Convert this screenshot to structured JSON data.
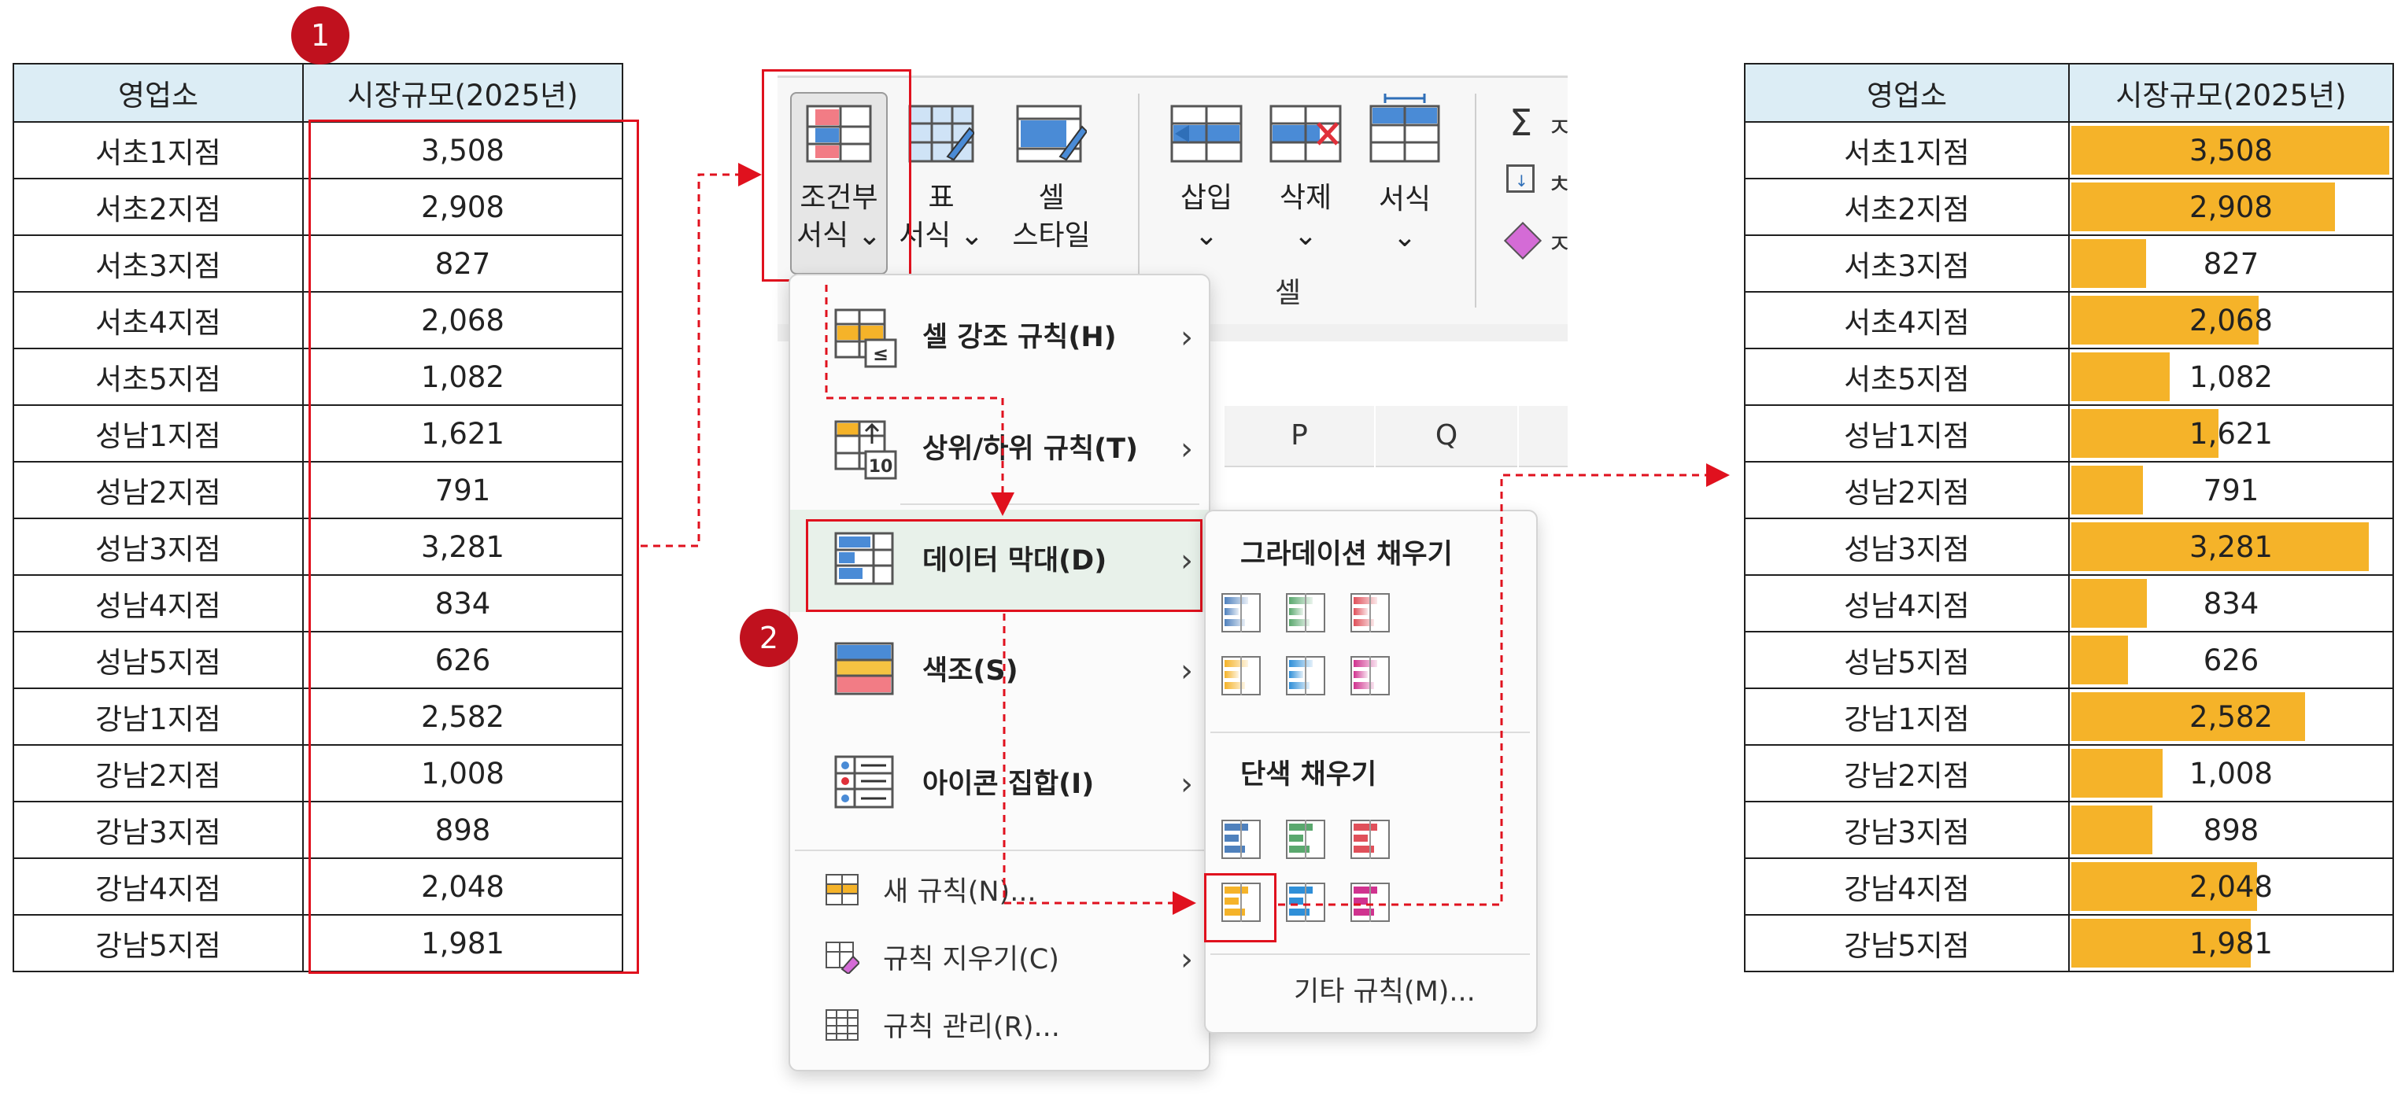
{
  "badges": [
    "1",
    "2"
  ],
  "left_table": {
    "headers": [
      "영업소",
      "시장규모(2025년)"
    ],
    "rows": [
      [
        "서초1지점",
        "3,508"
      ],
      [
        "서초2지점",
        "2,908"
      ],
      [
        "서초3지점",
        "827"
      ],
      [
        "서초4지점",
        "2,068"
      ],
      [
        "서초5지점",
        "1,082"
      ],
      [
        "성남1지점",
        "1,621"
      ],
      [
        "성남2지점",
        "791"
      ],
      [
        "성남3지점",
        "3,281"
      ],
      [
        "성남4지점",
        "834"
      ],
      [
        "성남5지점",
        "626"
      ],
      [
        "강남1지점",
        "2,582"
      ],
      [
        "강남2지점",
        "1,008"
      ],
      [
        "강남3지점",
        "898"
      ],
      [
        "강남4지점",
        "2,048"
      ],
      [
        "강남5지점",
        "1,981"
      ]
    ]
  },
  "right_table": {
    "headers": [
      "영업소",
      "시장규모(2025년)"
    ],
    "rows": [
      [
        "서초1지점",
        "3,508"
      ],
      [
        "서초2지점",
        "2,908"
      ],
      [
        "서초3지점",
        "827"
      ],
      [
        "서초4지점",
        "2,068"
      ],
      [
        "서초5지점",
        "1,082"
      ],
      [
        "성남1지점",
        "1,621"
      ],
      [
        "성남2지점",
        "791"
      ],
      [
        "성남3지점",
        "3,281"
      ],
      [
        "성남4지점",
        "834"
      ],
      [
        "성남5지점",
        "626"
      ],
      [
        "강남1지점",
        "2,582"
      ],
      [
        "강남2지점",
        "1,008"
      ],
      [
        "강남3지점",
        "898"
      ],
      [
        "강남4지점",
        "2,048"
      ],
      [
        "강남5지점",
        "1,981"
      ]
    ],
    "bar_values": [
      3508,
      2908,
      827,
      2068,
      1082,
      1621,
      791,
      3281,
      834,
      626,
      2582,
      1008,
      898,
      2048,
      1981
    ],
    "bar_max": 3508,
    "bar_color": "#f5b329"
  },
  "ribbon": {
    "cond_format": [
      "조건부",
      "서식 ⌄"
    ],
    "table_format": [
      "표",
      "서식 ⌄"
    ],
    "cell_style": [
      "셀",
      "스타일 ⌄"
    ],
    "insert": [
      "삽입",
      "⌄"
    ],
    "delete": [
      "삭제",
      "⌄"
    ],
    "format": [
      "서식",
      "⌄"
    ],
    "group_label": "셀",
    "edit_items": [
      "Σ",
      "ㅈ",
      "ㅊ",
      "ㅈ"
    ]
  },
  "sheet_columns": [
    "P",
    "Q"
  ],
  "cf_menu": {
    "highlight": "셀 강조 규칙(H)",
    "topbottom": "상위/하위 규칙(T)",
    "databar": "데이터 막대(D)",
    "colorscale": "색조(S)",
    "iconset": "아이콘 집합(I)",
    "new_rule": "새 규칙(N)...",
    "clear_rules": "규칙 지우기(C)",
    "manage_rules": "규칙 관리(R)...",
    "chevron": "›"
  },
  "databar_submenu": {
    "gradient_title": "그라데이션 채우기",
    "solid_title": "단색 채우기",
    "more_rules": "기타 규칙(M)...",
    "colors": [
      "#4f81bd",
      "#5aa86e",
      "#e0505a",
      "#f5b329",
      "#2f8fd8",
      "#d0338f"
    ]
  }
}
